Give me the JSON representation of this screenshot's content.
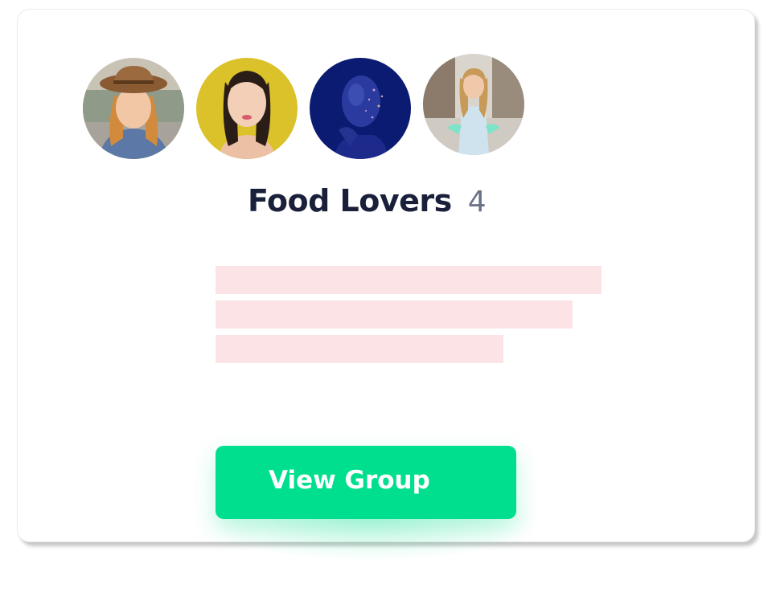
{
  "group": {
    "name": "Food Lovers",
    "member_count": "4"
  },
  "members": [
    {
      "icon": "member-avatar-hat-woman"
    },
    {
      "icon": "member-avatar-yellow-bg-woman"
    },
    {
      "icon": "member-avatar-blue-glitter-portrait"
    },
    {
      "icon": "member-avatar-street-woman"
    }
  ],
  "description_placeholder_lines": 3,
  "actions": {
    "view_group_label": "View Group"
  },
  "colors": {
    "primary": "#00df8e",
    "title": "#1a1f3a",
    "count": "#6b7187",
    "placeholder": "#fce4e6"
  }
}
